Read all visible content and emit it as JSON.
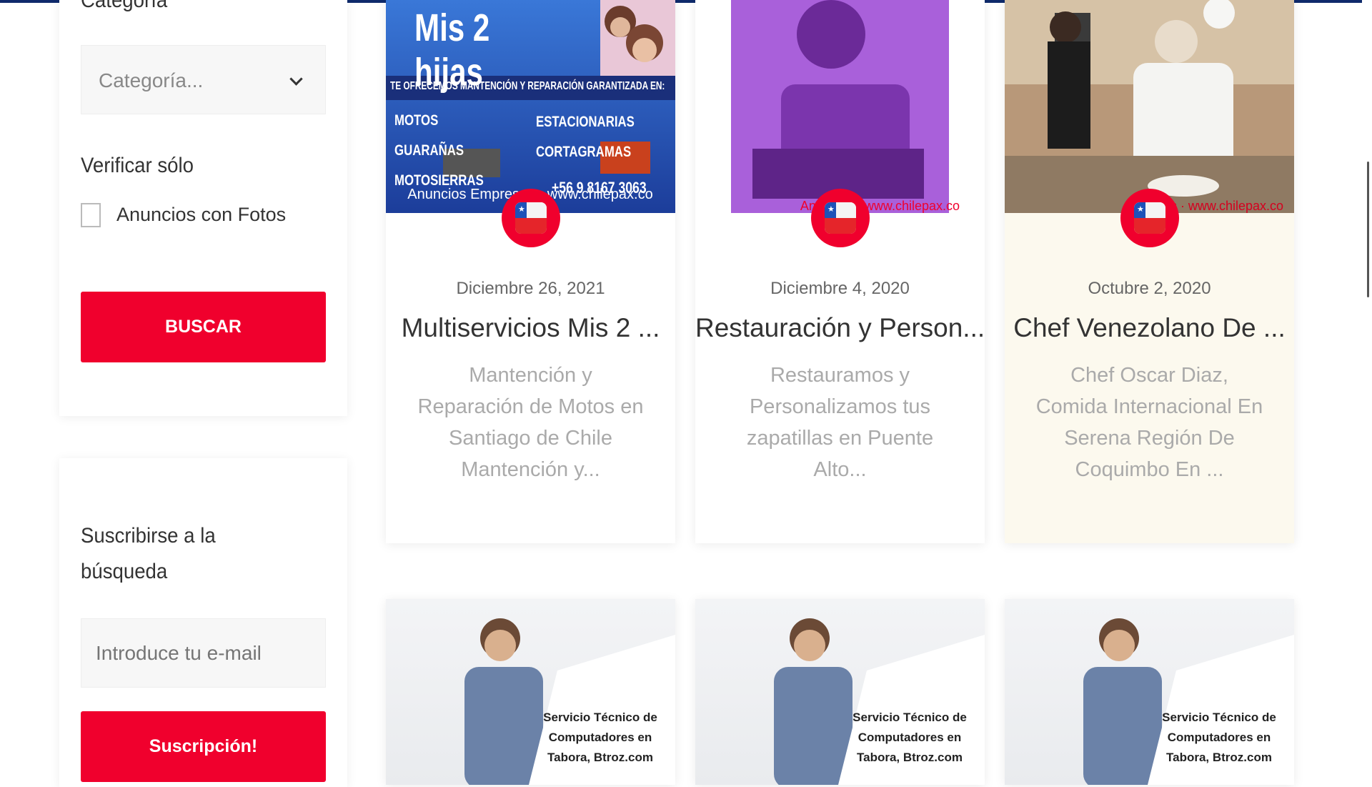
{
  "sidebar": {
    "category_heading": "Categoría",
    "category_select_value": "Categoría...",
    "verify_heading": "Verificar sólo",
    "photos_checkbox_label": "Anuncios con Fotos",
    "search_button": "BUSCAR",
    "subscribe_heading_line1": "Suscribirse a la",
    "subscribe_heading_line2": "búsqueda",
    "email_placeholder": "Introduce tu e-mail",
    "subscribe_button": "Suscripción!"
  },
  "listings": [
    {
      "date": "Diciembre 26, 2021",
      "title": "Multiservicios Mis 2 ...",
      "description": "Mantención y Reparación de Motos en Santiago de Chile Mantención y...",
      "image": {
        "title": "Mis 2 hijas",
        "banner": "TE OFRECEMOS MANTENCIÓN Y REPARACIÓN GARANTIZADA EN:",
        "left_items": [
          "MOTOS",
          "GUARAÑAS",
          "MOTOSIERRAS"
        ],
        "right_items": [
          "ESTACIONARIAS",
          "CORTAGRAMAS"
        ],
        "phone": "+56 9 8167 3063"
      }
    },
    {
      "date": "Diciembre 4, 2020",
      "title": "Restauración y Person...",
      "description": "Restauramos y Personalizamos tus zapatillas en Puente Alto..."
    },
    {
      "date": "Octubre 2, 2020",
      "title": "Chef Venezolano De ...",
      "description": "Chef Oscar Diaz, Comida Internacional En Serena Región De Coquimbo En ..."
    }
  ],
  "row2_text": [
    "Servicio Técnico de",
    "Computadores en",
    "Tabora, Btroz.com"
  ],
  "colors": {
    "accent": "#f0002d",
    "featured_bg": "#fcf9ee"
  },
  "icons": [
    "chevron-down-icon",
    "chile-flag-icon"
  ]
}
